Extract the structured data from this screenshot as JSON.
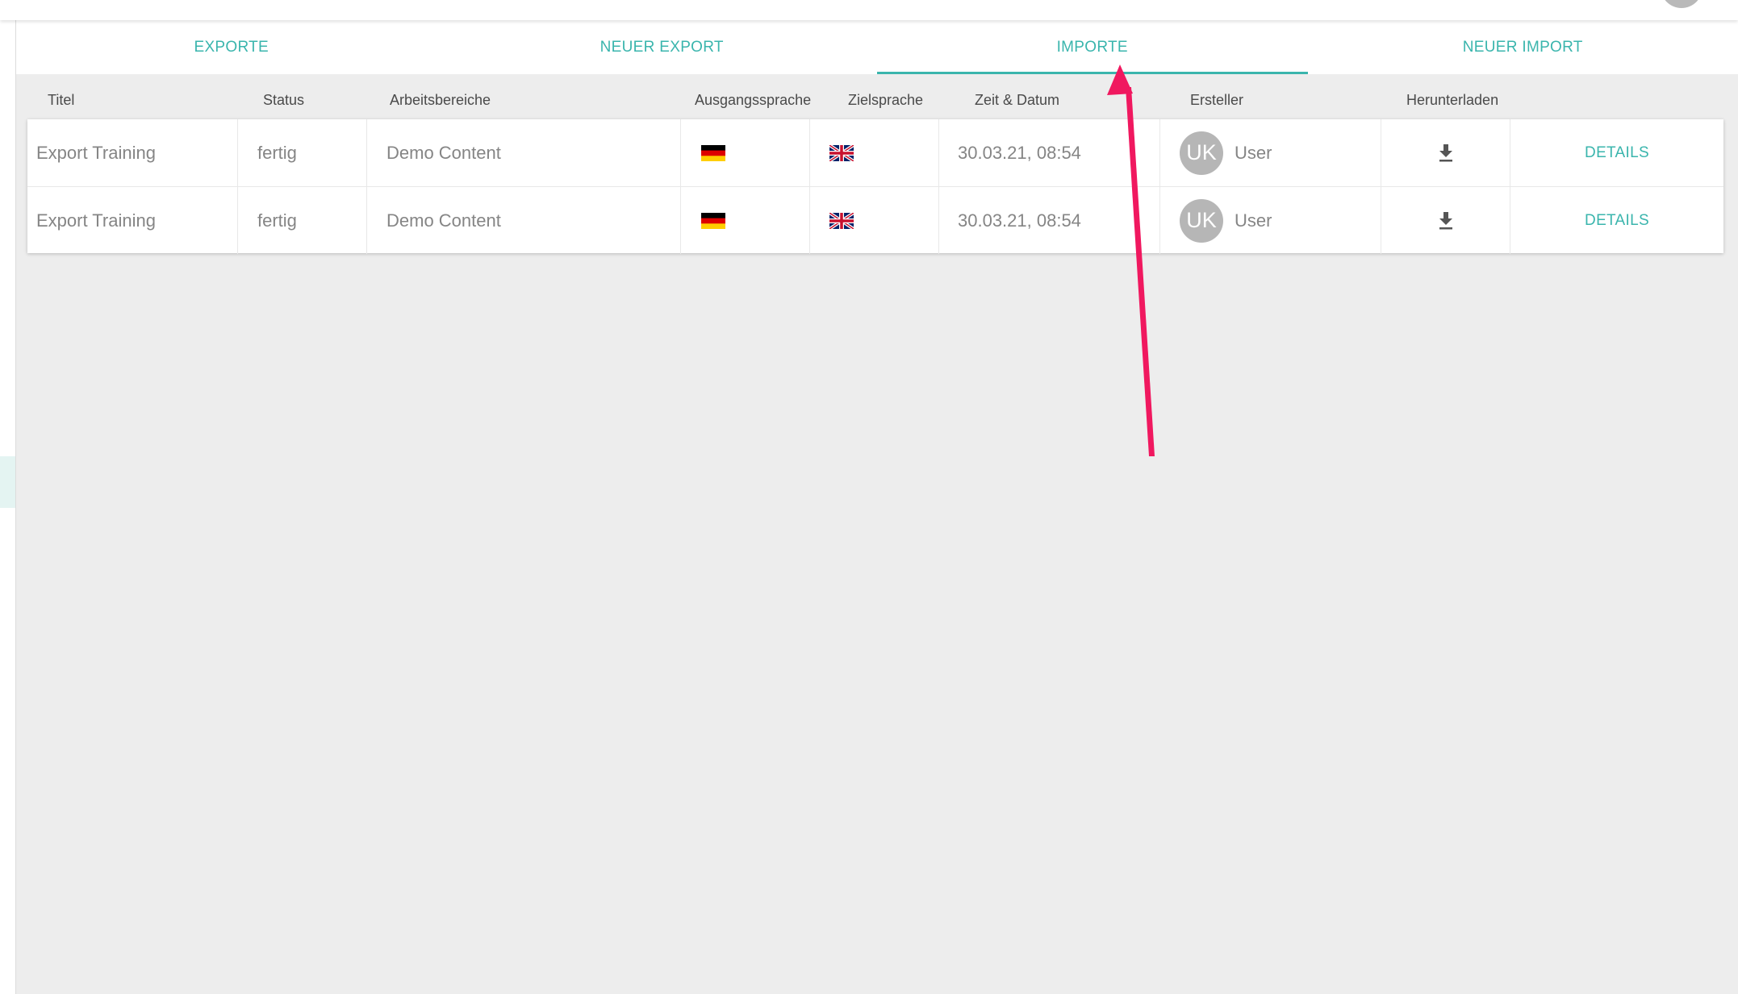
{
  "tabs": [
    {
      "label": "EXPORTE"
    },
    {
      "label": "NEUER EXPORT"
    },
    {
      "label": "IMPORTE",
      "active": true
    },
    {
      "label": "NEUER IMPORT"
    }
  ],
  "table": {
    "headers": [
      "Titel",
      "Status",
      "Arbeitsbereiche",
      "Ausgangssprache",
      "Zielsprache",
      "Zeit & Datum",
      "Ersteller",
      "Herunterladen"
    ],
    "rows": [
      {
        "title": "Export Training",
        "status": "fertig",
        "area": "Demo Content",
        "source_lang_icon": "flag-de-icon",
        "target_lang_icon": "flag-uk-icon",
        "datetime": "30.03.21, 08:54",
        "avatar_initials": "UK",
        "user": "User",
        "download_icon": "download-icon",
        "details_label": "DETAILS"
      },
      {
        "title": "Export Training",
        "status": "fertig",
        "area": "Demo Content",
        "source_lang_icon": "flag-de-icon",
        "target_lang_icon": "flag-uk-icon",
        "datetime": "30.03.21, 08:54",
        "avatar_initials": "UK",
        "user": "User",
        "download_icon": "download-icon",
        "details_label": "DETAILS"
      }
    ]
  },
  "colors": {
    "accent": "#3ab5ad",
    "annotation_arrow": "#f0185f",
    "background": "#ededed"
  }
}
